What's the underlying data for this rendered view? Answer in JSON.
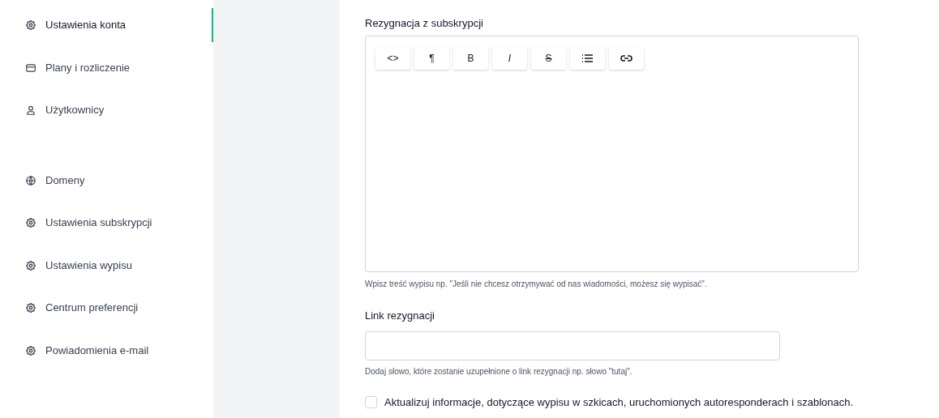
{
  "sidebar": {
    "groups": [
      {
        "items": [
          {
            "label": "Ustawienia konta",
            "kind": "gear",
            "selected": true
          },
          {
            "label": "Plany i rozliczenie",
            "kind": "card",
            "selected": false
          },
          {
            "label": "Użytkownicy",
            "kind": "user",
            "selected": false
          }
        ]
      },
      {
        "items": [
          {
            "label": "Domeny",
            "kind": "globe",
            "selected": false
          },
          {
            "label": "Ustawienia subskrypcji",
            "kind": "gear",
            "selected": false
          },
          {
            "label": "Ustawienia wypisu",
            "kind": "gear",
            "selected": false
          },
          {
            "label": "Centrum preferencji",
            "kind": "gear",
            "selected": false
          },
          {
            "label": "Powiadomienia e-mail",
            "kind": "gear",
            "selected": false
          }
        ]
      }
    ]
  },
  "unsubscribe_editor": {
    "label": "Rezygnacja z subskrypcji",
    "toolbar": [
      {
        "kind": "text",
        "label": "<>"
      },
      {
        "kind": "text",
        "label": "¶"
      },
      {
        "kind": "bold",
        "label": "B"
      },
      {
        "kind": "italic",
        "label": "I"
      },
      {
        "kind": "strike",
        "label": "S"
      },
      {
        "kind": "list"
      },
      {
        "kind": "link"
      }
    ],
    "hint": "Wpisz treść wypisu np. \"Jeśli nie chcesz otrzymywać od nas wiadomości, możesz się wypisać\"."
  },
  "unsubscribe_link": {
    "label": "Link rezygnacji",
    "hint": "Dodaj słowo, które zostanie uzupełnione o link rezygnacji np. słowo \"tutaj\"."
  },
  "update_option": {
    "label": "Aktualizuj informacje, dotyczące wypisu w szkicach, uruchomionych autoresponderach i szablonach.",
    "checked": false
  }
}
